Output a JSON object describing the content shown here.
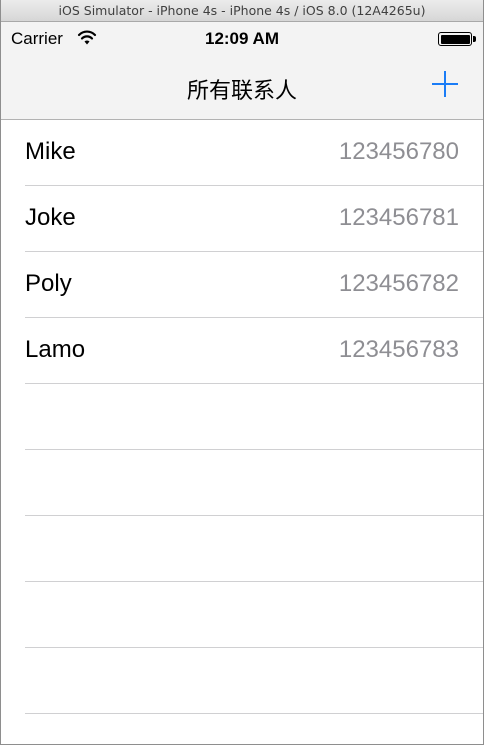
{
  "simulator": {
    "window_title": "iOS Simulator - iPhone 4s - iPhone 4s / iOS 8.0 (12A4265u)"
  },
  "status_bar": {
    "carrier": "Carrier",
    "time": "12:09 AM",
    "wifi_icon": "wifi-icon",
    "battery_icon": "battery-icon"
  },
  "nav_bar": {
    "title": "所有联系人",
    "add_icon": "plus-icon",
    "accent_color": "#1a7cf6"
  },
  "contacts": [
    {
      "name": "Mike",
      "phone": "123456780"
    },
    {
      "name": "Joke",
      "phone": "123456781"
    },
    {
      "name": "Poly",
      "phone": "123456782"
    },
    {
      "name": "Lamo",
      "phone": "123456783"
    }
  ]
}
